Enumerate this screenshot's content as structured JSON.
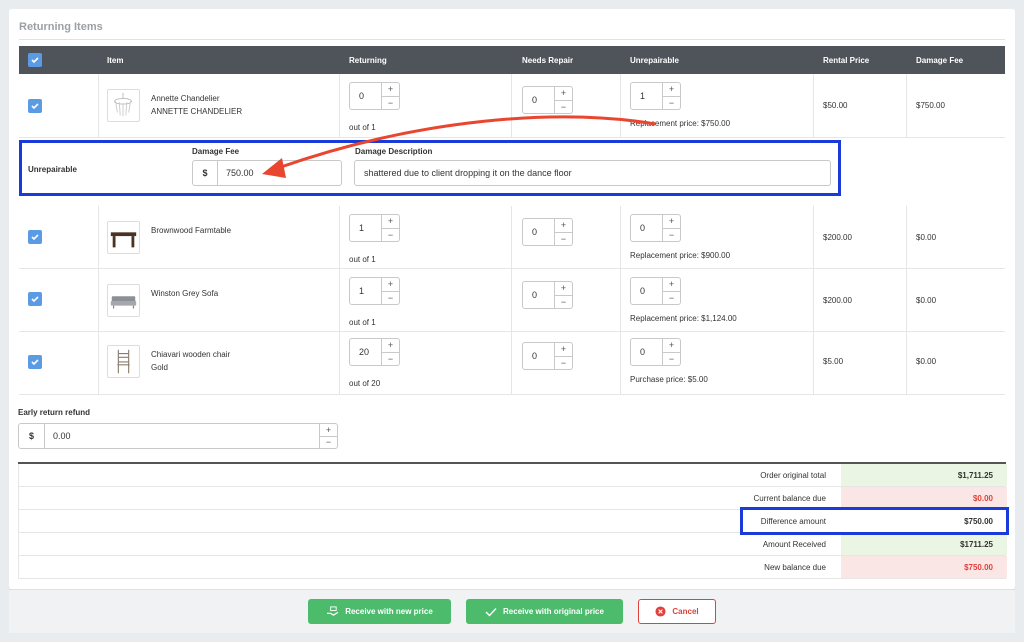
{
  "section_title": "Returning Items",
  "table": {
    "headers": {
      "item": "Item",
      "returning": "Returning",
      "needs_repair": "Needs Repair",
      "unrepairable": "Unrepairable",
      "rental_price": "Rental Price",
      "damage_fee": "Damage Fee"
    }
  },
  "items": [
    {
      "name": "Annette Chandelier",
      "subtitle": "ANNETTE CHANDELIER",
      "returning": "0",
      "out_of": "out of 1",
      "needs_repair": "0",
      "unrepairable": "1",
      "price_note": "Replacement price: $750.00",
      "rental_price": "$50.00",
      "damage_fee": "$750.00"
    },
    {
      "name": "Brownwood Farmtable",
      "subtitle": "",
      "returning": "1",
      "out_of": "out of 1",
      "needs_repair": "0",
      "unrepairable": "0",
      "price_note": "Replacement price: $900.00",
      "rental_price": "$200.00",
      "damage_fee": "$0.00"
    },
    {
      "name": "Winston Grey Sofa",
      "subtitle": "",
      "returning": "1",
      "out_of": "out of 1",
      "needs_repair": "0",
      "unrepairable": "0",
      "price_note": "Replacement price: $1,124.00",
      "rental_price": "$200.00",
      "damage_fee": "$0.00"
    },
    {
      "name": "Chiavari wooden chair",
      "subtitle": "Gold",
      "returning": "20",
      "out_of": "out of 20",
      "needs_repair": "0",
      "unrepairable": "0",
      "price_note": "Purchase price: $5.00",
      "rental_price": "$5.00",
      "damage_fee": "$0.00"
    }
  ],
  "unrepairable_panel": {
    "label": "Unrepairable",
    "damage_fee_label": "Damage Fee",
    "currency": "$",
    "damage_fee_value": "750.00",
    "description_label": "Damage Description",
    "description_value": "shattered due to client dropping it on the dance floor"
  },
  "early_refund": {
    "label": "Early return refund",
    "currency": "$",
    "value": "0.00"
  },
  "summary": [
    {
      "label": "Order original total",
      "value": "$1,711.25",
      "tone": "green"
    },
    {
      "label": "Current balance due",
      "value": "$0.00",
      "tone": "red"
    },
    {
      "label": "Difference amount",
      "value": "$750.00",
      "tone": "plain"
    },
    {
      "label": "Amount Received",
      "value": "$1711.25",
      "tone": "green"
    },
    {
      "label": "New balance due",
      "value": "$750.00",
      "tone": "red"
    }
  ],
  "buttons": {
    "receive_new": "Receive with new price",
    "receive_original": "Receive with original price",
    "cancel": "Cancel"
  },
  "colors": {
    "header_bg": "#4f545a",
    "checkbox": "#5b9be3",
    "highlight_border": "#1a3ad9",
    "arrow": "#e8462e",
    "green_btn": "#4cbb6c",
    "cancel_red": "#e0413b",
    "green_cell": "#eaf5e3",
    "red_cell": "#fbe6e6",
    "red_text": "#e0413b"
  }
}
